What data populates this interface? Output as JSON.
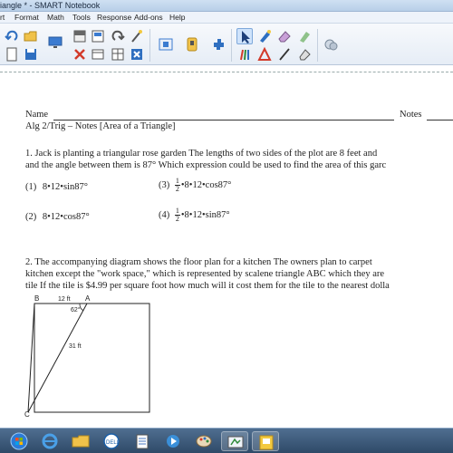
{
  "window": {
    "title": "iangle * - SMART Notebook"
  },
  "menu": {
    "items": [
      "rt",
      "Format",
      "Math",
      "Tools",
      "Response",
      "Add-ons",
      "Help"
    ]
  },
  "document": {
    "name_label": "Name",
    "notes_label": "Notes",
    "subtitle": "Alg 2/Trig – Notes [Area of  a Triangle]",
    "q1": {
      "line1": "1.   Jack is planting a triangular rose garden   The lengths of two sides of the plot are 8 feet and",
      "line2": "and the angle between them is 87°   Which expression could be used to find the area of this garc",
      "choices": [
        {
          "num": "(1)",
          "text": "8•12•sin87°"
        },
        {
          "num": "(2)",
          "text": "8•12•cos87°"
        },
        {
          "num": "(3)",
          "text": "•8•12•cos87°",
          "frac_n": "1",
          "frac_d": "2"
        },
        {
          "num": "(4)",
          "text": "•8•12•sin87°",
          "frac_n": "1",
          "frac_d": "2"
        }
      ]
    },
    "q2": {
      "line1": "2.   The accompanying diagram shows the floor plan for a kitchen   The owners plan to carpet",
      "line2": "kitchen except the \"work space,\" which is represented by scalene triangle ABC which they are",
      "line3": "tile  If the tile is $4.99 per square foot how much will it cost them for the tile to the nearest dolla"
    },
    "diagram": {
      "label_b": "B",
      "label_a": "A",
      "label_c": "C",
      "side_top": "12 ft",
      "side_diag": "31 ft",
      "angle": "62°"
    }
  },
  "colors": {
    "titlebar": "#c4d7ee",
    "taskbar": "#3c5a7c",
    "accent_blue": "#2f6fc0",
    "accent_red": "#d23a2a"
  }
}
